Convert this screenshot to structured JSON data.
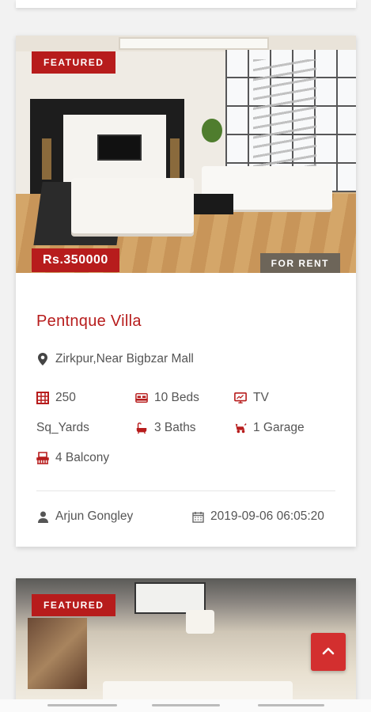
{
  "listing": {
    "badge_featured": "FEATURED",
    "price": "Rs.350000",
    "badge_type": "FOR RENT",
    "title": "Pentnque Villa",
    "address": "Zirkpur,Near Bigbzar Mall",
    "features": {
      "area_value": "250",
      "area_unit": "Sq_Yards",
      "beds": "10 Beds",
      "baths": "3 Baths",
      "tv": "TV",
      "garage": "1 Garage",
      "balcony": "4 Balcony"
    },
    "agent": "Arjun Gongley",
    "date": "2019-09-06 06:05:20"
  },
  "listing2": {
    "badge_featured": "FEATURED"
  },
  "colors": {
    "accent": "#b71c1c",
    "rent_badge": "#6d6559",
    "text": "#555555"
  },
  "icons": {
    "address": "map-marker-icon",
    "area": "area-grid-icon",
    "beds": "bed-icon",
    "baths": "bathtub-icon",
    "tv": "tv-icon",
    "garage": "car-icon",
    "balcony": "balcony-icon",
    "agent": "user-icon",
    "date": "calendar-icon",
    "scroll_top": "chevron-up-icon"
  }
}
